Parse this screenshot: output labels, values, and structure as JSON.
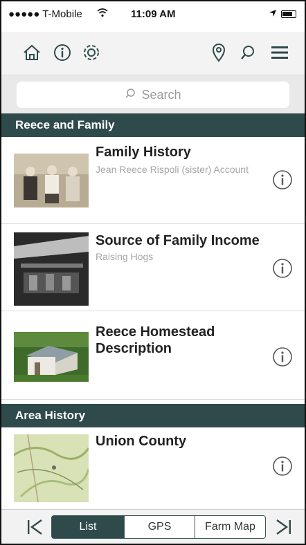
{
  "status_bar": {
    "carrier": "●●●●● T-Mobile",
    "time": "11:09 AM"
  },
  "toolbar": {
    "left_icons": [
      "home-icon",
      "info-icon",
      "gear-icon"
    ],
    "right_icons": [
      "location-pin-icon",
      "search-icon",
      "menu-icon"
    ]
  },
  "search": {
    "placeholder": "Search"
  },
  "sections": [
    {
      "title": "Reece and Family",
      "items": [
        {
          "title": "Family History",
          "subtitle": "Jean Reece Rispoli (sister) Account"
        },
        {
          "title": "Source of Family Income",
          "subtitle": "Raising Hogs"
        },
        {
          "title": "Reece Homestead Description",
          "subtitle": ""
        }
      ]
    },
    {
      "title": "Area History",
      "items": [
        {
          "title": "Union County",
          "subtitle": ""
        }
      ]
    }
  ],
  "bottom_bar": {
    "tabs": [
      "List",
      "GPS",
      "Farm Map"
    ],
    "selected_tab": "List",
    "accent_color": "#2f4a4a"
  }
}
